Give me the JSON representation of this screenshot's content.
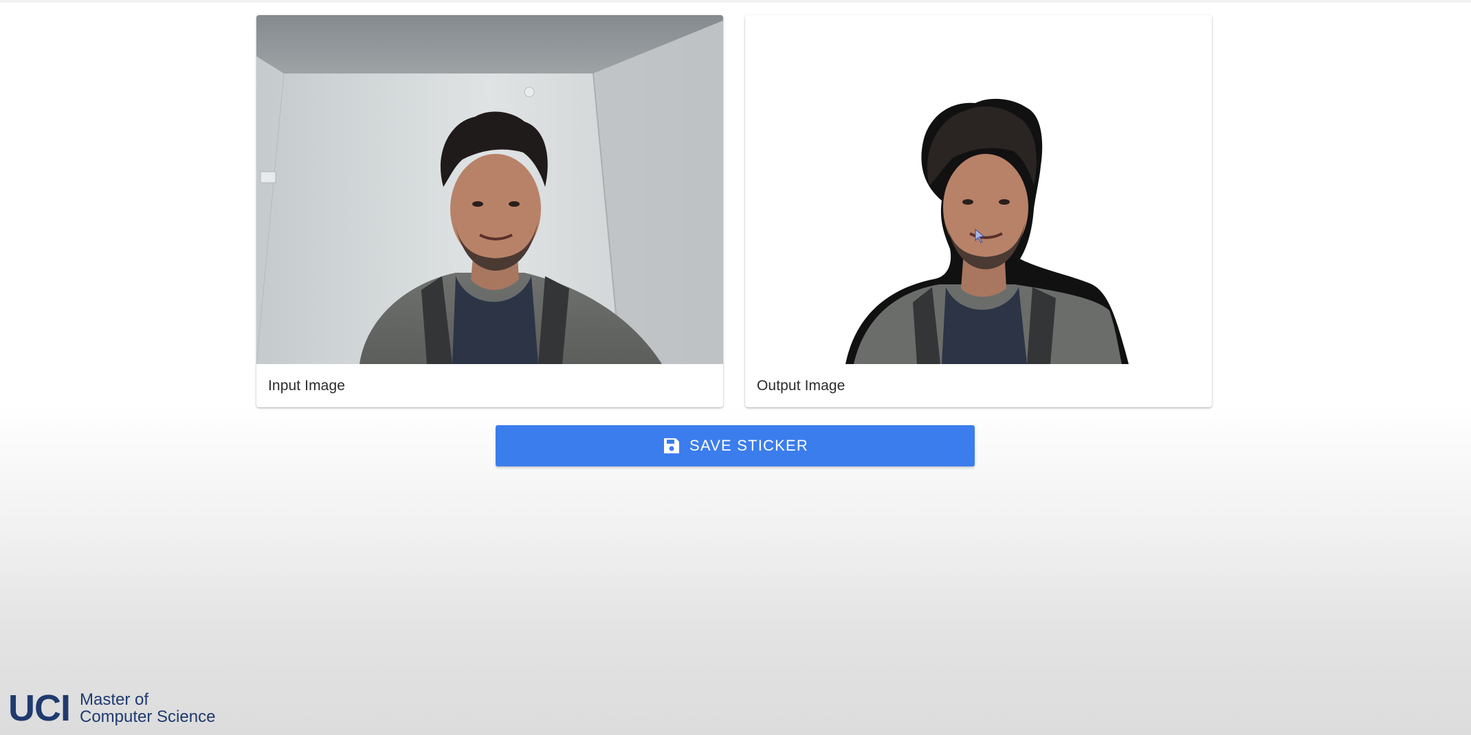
{
  "cards": {
    "input": {
      "caption": "Input Image"
    },
    "output": {
      "caption": "Output Image"
    }
  },
  "actions": {
    "save_label": "SAVE STICKER",
    "save_icon": "save-icon"
  },
  "branding": {
    "mark": "UCI",
    "line1": "Master of",
    "line2": "Computer Science"
  },
  "colors": {
    "primary": "#3b7ded",
    "brand_navy": "#1f3a6e"
  }
}
